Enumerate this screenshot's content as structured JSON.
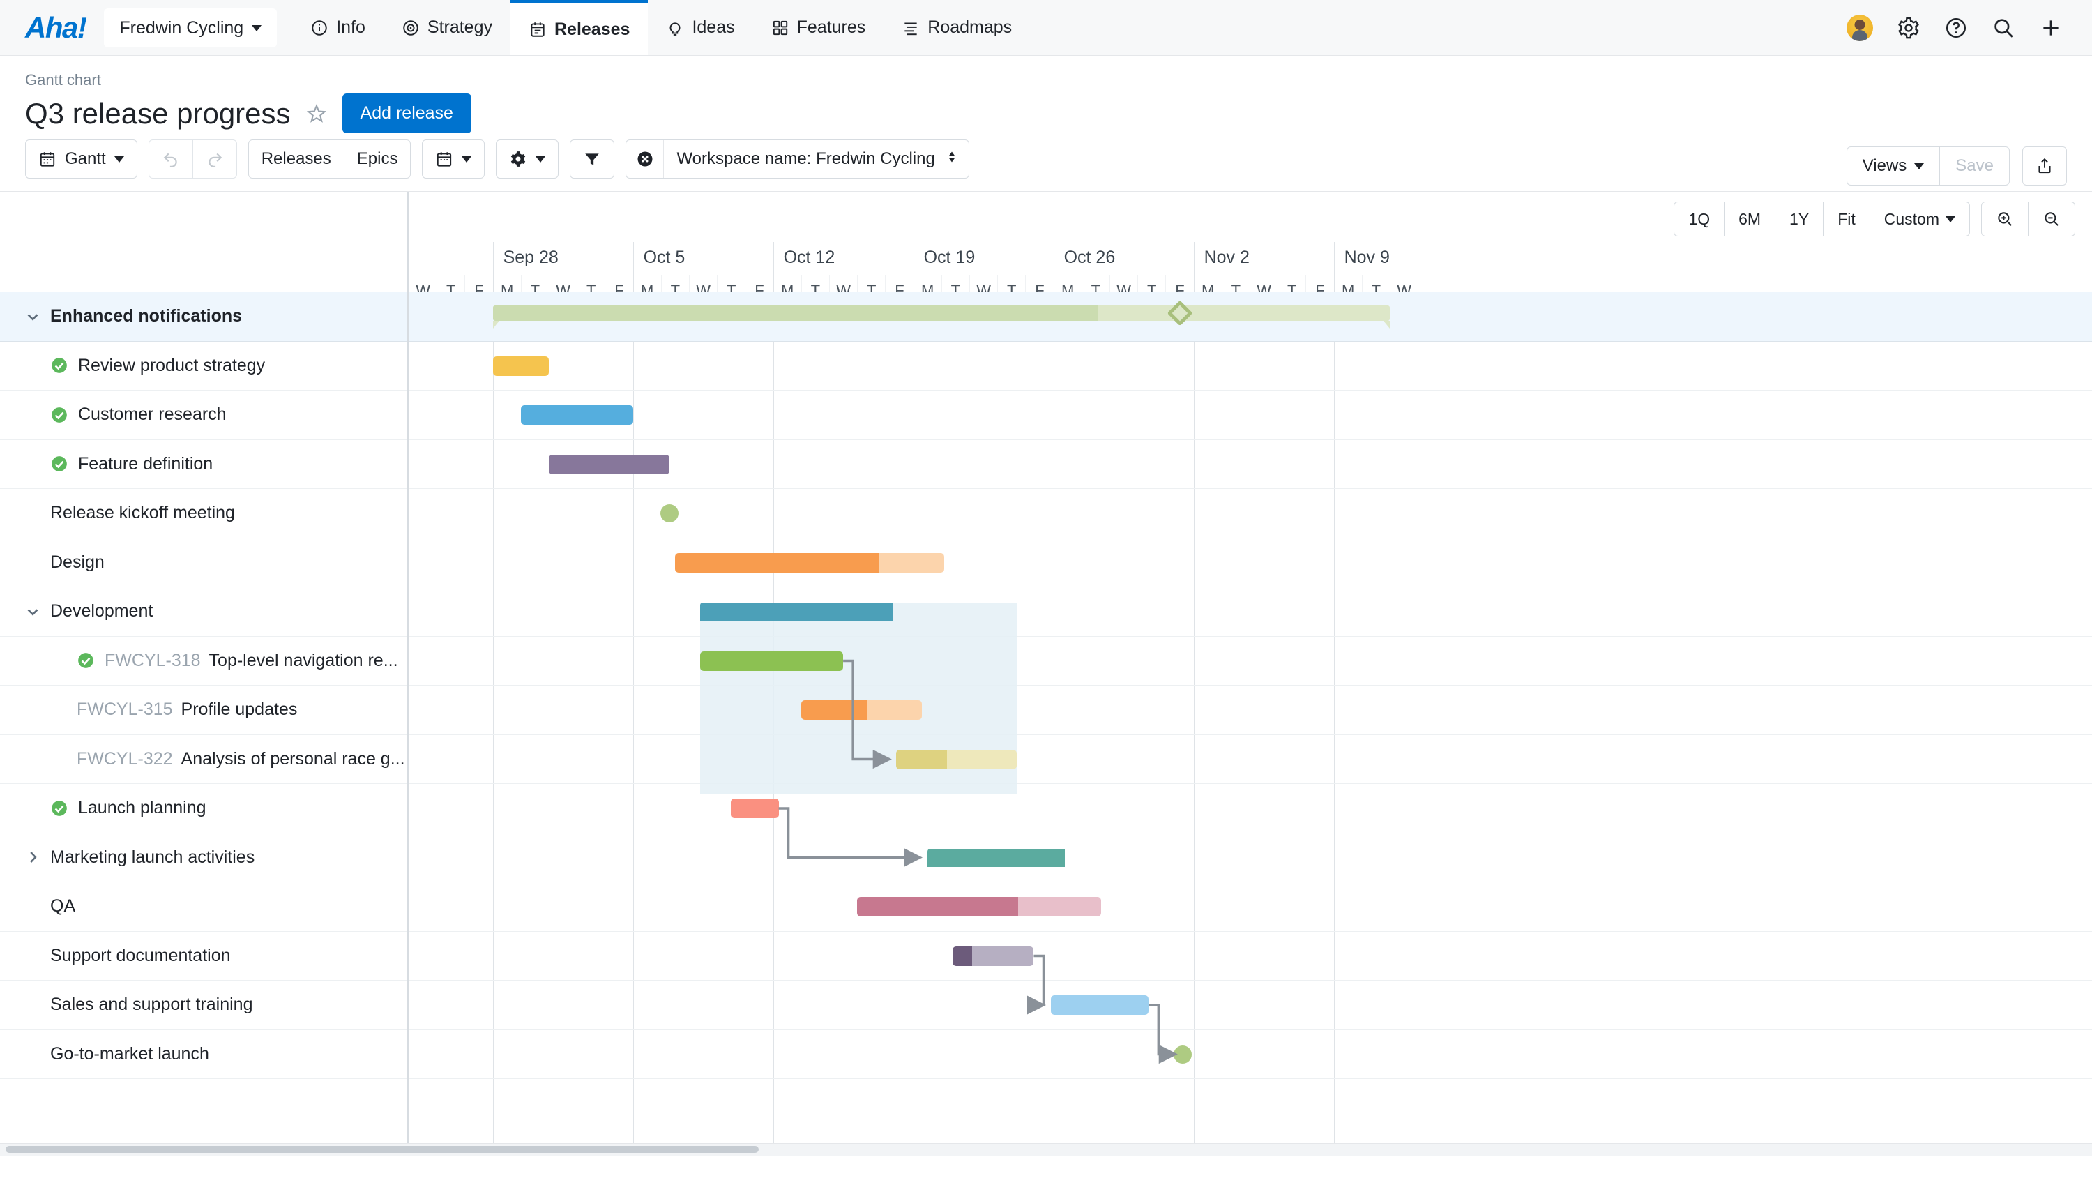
{
  "app": {
    "logo": "Aha!",
    "workspace_chip": "Fredwin Cycling",
    "nav": [
      {
        "label": "Info",
        "icon": "info-icon",
        "active": false
      },
      {
        "label": "Strategy",
        "icon": "target-icon",
        "active": false
      },
      {
        "label": "Releases",
        "icon": "calendar-icon",
        "active": true
      },
      {
        "label": "Ideas",
        "icon": "lightbulb-icon",
        "active": false
      },
      {
        "label": "Features",
        "icon": "grid-icon",
        "active": false
      },
      {
        "label": "Roadmaps",
        "icon": "roadmap-icon",
        "active": false
      }
    ],
    "right_icons": [
      "avatar",
      "gear-icon",
      "help-icon",
      "search-icon",
      "plus-icon"
    ]
  },
  "header": {
    "breadcrumb": "Gantt chart",
    "title": "Q3 release progress",
    "favorite_icon": "star-icon",
    "add_release_label": "Add release",
    "views_label": "Views",
    "save_label": "Save",
    "share_icon": "share-icon"
  },
  "toolbar": {
    "view_label": "Gantt",
    "undo_icon": "undo-icon",
    "redo_icon": "redo-icon",
    "tabs": [
      {
        "label": "Releases",
        "selected": true
      },
      {
        "label": "Epics",
        "selected": false
      }
    ],
    "date_icon": "calendar-icon",
    "settings_icon": "gear-icon",
    "filter_icon": "filter-icon",
    "filter_chip": {
      "clear_icon": "clear-icon",
      "text": "Workspace name: Fredwin Cycling",
      "sort_icon": "updown-icon"
    }
  },
  "zoom_controls": {
    "ranges": [
      "1Q",
      "6M",
      "1Y",
      "Fit"
    ],
    "custom_label": "Custom",
    "zoom_in_icon": "zoom-in-icon",
    "zoom_out_icon": "zoom-out-icon"
  },
  "chart_data": {
    "type": "gantt",
    "title": "Q3 release progress",
    "axis": {
      "week_labels": [
        "Sep 28",
        "Oct 5",
        "Oct 12",
        "Oct 19",
        "Oct 26",
        "Nov 2",
        "Nov 9"
      ],
      "day_labels": [
        "W",
        "T",
        "F",
        "M",
        "T",
        "W",
        "T",
        "F",
        "M",
        "T",
        "W",
        "T",
        "F",
        "M",
        "T",
        "W",
        "T",
        "F",
        "M",
        "T",
        "W",
        "T",
        "F",
        "M",
        "T",
        "W",
        "T",
        "F",
        "M",
        "T",
        "W",
        "T",
        "F",
        "M",
        "T",
        "W"
      ],
      "day_width": 40.2,
      "first_week_offset_days": 3
    },
    "rows": [
      {
        "type": "release",
        "label": "Enhanced notifications",
        "expanded": true,
        "indent": 0,
        "bar": {
          "kind": "release",
          "start": 3,
          "end": 35,
          "progress_end": 24.6,
          "milestone_at": 27.5,
          "color": "#dde7c8",
          "progress_color": "#cbdcb0",
          "milestone_color": "#a8bf7c"
        }
      },
      {
        "type": "task",
        "label": "Review product strategy",
        "complete": true,
        "indent": 1,
        "bar": {
          "kind": "task",
          "start": 3,
          "end": 5,
          "progress": 100,
          "color": "#f5c44e",
          "light": "#fae2a3"
        }
      },
      {
        "type": "task",
        "label": "Customer research",
        "complete": true,
        "indent": 1,
        "bar": {
          "kind": "task",
          "start": 4,
          "end": 8,
          "progress": 100,
          "color": "#55aede",
          "light": "#a9d7ef"
        }
      },
      {
        "type": "task",
        "label": "Feature definition",
        "complete": true,
        "indent": 1,
        "bar": {
          "kind": "task",
          "start": 5,
          "end": 9.3,
          "progress": 100,
          "color": "#87779b",
          "light": "#c3bbcd"
        }
      },
      {
        "type": "milestone",
        "label": "Release kickoff meeting",
        "indent": 1,
        "bar": {
          "kind": "milestone",
          "at": 9.3,
          "color": "#aecb82"
        }
      },
      {
        "type": "task",
        "label": "Design",
        "indent": 1,
        "bar": {
          "kind": "task",
          "start": 9.5,
          "end": 19.1,
          "progress": 76,
          "color": "#f89c4e",
          "light": "#fcd4ac"
        }
      },
      {
        "type": "group",
        "label": "Development",
        "expanded": true,
        "indent": 0,
        "bar": {
          "kind": "group",
          "start": 10.4,
          "end": 21.7,
          "progress": 61,
          "color": "#4ca0b8",
          "light": "#a3cfdd"
        }
      },
      {
        "type": "feature",
        "ref": "FWCYL-318",
        "label": "Top-level navigation re...",
        "complete": true,
        "indent": 2,
        "bar": {
          "kind": "task",
          "start": 10.4,
          "end": 15.5,
          "progress": 100,
          "color": "#8cc152",
          "light": "#c6e0a0"
        }
      },
      {
        "type": "feature",
        "ref": "FWCYL-315",
        "label": "Profile updates",
        "complete": false,
        "indent": 2,
        "bar": {
          "kind": "task",
          "start": 14,
          "end": 18.3,
          "progress": 55,
          "color": "#f89c4e",
          "light": "#fcd4ac"
        }
      },
      {
        "type": "feature",
        "ref": "FWCYL-322",
        "label": "Analysis of personal race g...",
        "complete": false,
        "indent": 2,
        "bar": {
          "kind": "task",
          "start": 17.4,
          "end": 21.7,
          "progress": 42,
          "color": "#ded280",
          "light": "#eee8bb"
        }
      },
      {
        "type": "task",
        "label": "Launch planning",
        "complete": true,
        "indent": 1,
        "bar": {
          "kind": "task",
          "start": 11.5,
          "end": 13.2,
          "progress": 100,
          "color": "#fa9080",
          "light": "#fdc3b8"
        }
      },
      {
        "type": "group",
        "label": "Marketing launch activities",
        "expanded": false,
        "indent": 0,
        "bar": {
          "kind": "group2",
          "start": 18.5,
          "end": 25.4,
          "progress": 71,
          "color": "#5bab9f",
          "light": "#addbd4"
        }
      },
      {
        "type": "task",
        "label": "QA",
        "indent": 1,
        "bar": {
          "kind": "task",
          "start": 16,
          "end": 24.7,
          "progress": 66,
          "color": "#c7788f",
          "light": "#e8bfca"
        }
      },
      {
        "type": "task",
        "label": "Support documentation",
        "indent": 1,
        "bar": {
          "kind": "task",
          "start": 19.4,
          "end": 22.3,
          "progress": 24,
          "color": "#6c5b7b",
          "light": "#b6afc2"
        }
      },
      {
        "type": "task",
        "label": "Sales and support training",
        "indent": 1,
        "bar": {
          "kind": "task",
          "start": 22.9,
          "end": 26.4,
          "progress": 0,
          "color": "#9dd0f0",
          "light": "#9dd0f0"
        }
      },
      {
        "type": "milestone",
        "label": "Go-to-market launch",
        "indent": 1,
        "bar": {
          "kind": "milestone",
          "at": 27.6,
          "color": "#aecb82"
        }
      }
    ],
    "dependencies": [
      {
        "from_row": 7,
        "to_row": 9,
        "from_x": 15.5,
        "to_x": 17.4
      },
      {
        "from_row": 10,
        "to_row": 11,
        "from_x": 13.2,
        "to_x": 18.5
      },
      {
        "from_row": 13,
        "to_row": 14,
        "from_x": 22.3,
        "to_x": 22.9
      },
      {
        "from_row": 14,
        "to_row": 15,
        "from_x": 26.4,
        "to_x": 27.6
      }
    ]
  }
}
